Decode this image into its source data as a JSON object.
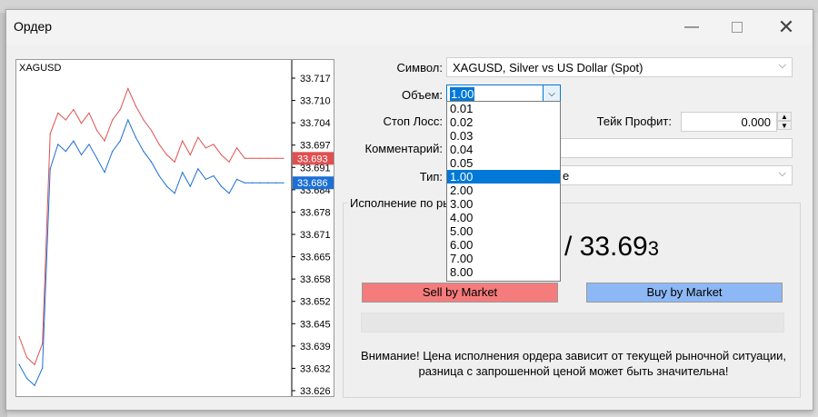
{
  "window": {
    "title": "Ордер",
    "minimize_icon": "minimize-icon",
    "maximize_icon": "maximize-icon",
    "close_icon": "close-icon"
  },
  "chart": {
    "symbol": "XAGUSD",
    "y_ticks": [
      "33.717",
      "33.710",
      "33.704",
      "33.697",
      "33.691",
      "33.684",
      "33.678",
      "33.671",
      "33.665",
      "33.658",
      "33.652",
      "33.645",
      "33.639",
      "33.632",
      "33.626"
    ],
    "ask_label": "33.693",
    "bid_label": "33.686",
    "ask_color": "#e05050",
    "bid_color": "#1c6fd6"
  },
  "chart_data": {
    "type": "line",
    "title": "XAGUSD",
    "ylim": [
      33.626,
      33.717
    ],
    "series": [
      {
        "name": "Ask",
        "values": [
          33.642,
          33.636,
          33.634,
          33.64,
          33.7,
          33.706,
          33.704,
          33.707,
          33.703,
          33.706,
          33.701,
          33.698,
          33.704,
          33.707,
          33.713,
          33.708,
          33.704,
          33.701,
          33.697,
          33.694,
          33.692,
          33.698,
          33.694,
          33.699,
          33.696,
          33.697,
          33.694,
          33.692,
          33.696,
          33.693,
          33.693,
          33.693,
          33.693,
          33.693,
          33.693
        ]
      },
      {
        "name": "Bid",
        "values": [
          33.634,
          33.63,
          33.628,
          33.633,
          33.69,
          33.697,
          33.695,
          33.698,
          33.694,
          33.697,
          33.693,
          33.689,
          33.695,
          33.698,
          33.704,
          33.699,
          33.695,
          33.692,
          33.688,
          33.685,
          33.683,
          33.689,
          33.685,
          33.69,
          33.687,
          33.688,
          33.685,
          33.683,
          33.687,
          33.686,
          33.686,
          33.686,
          33.686,
          33.686,
          33.686
        ]
      }
    ]
  },
  "form": {
    "symbol_label": "Символ:",
    "symbol_value": "XAGUSD, Silver vs US Dollar (Spot)",
    "volume_label": "Объем:",
    "volume_value": "1.00",
    "stoploss_label": "Стоп Лосс:",
    "takeprofit_label": "Тейк Профит:",
    "takeprofit_value": "0.000",
    "comment_label": "Комментарий:",
    "type_label": "Тип:",
    "type_value_tail": "е",
    "volume_options": [
      "0.01",
      "0.02",
      "0.03",
      "0.04",
      "0.05",
      "1.00",
      "2.00",
      "3.00",
      "4.00",
      "5.00",
      "6.00",
      "7.00",
      "8.00"
    ]
  },
  "execution": {
    "group_label": "Исполнение по ры",
    "price_text": "/ 33.69",
    "price_small": "3",
    "sell_label": "Sell by Market",
    "buy_label": "Buy by Market",
    "sell_color": "#f47c7c",
    "buy_color": "#8db8f5",
    "warning_line1": "Внимание! Цена исполнения ордера зависит от текущей рыночной ситуации,",
    "warning_line2": "разница с запрошенной ценой может быть значительна!"
  }
}
